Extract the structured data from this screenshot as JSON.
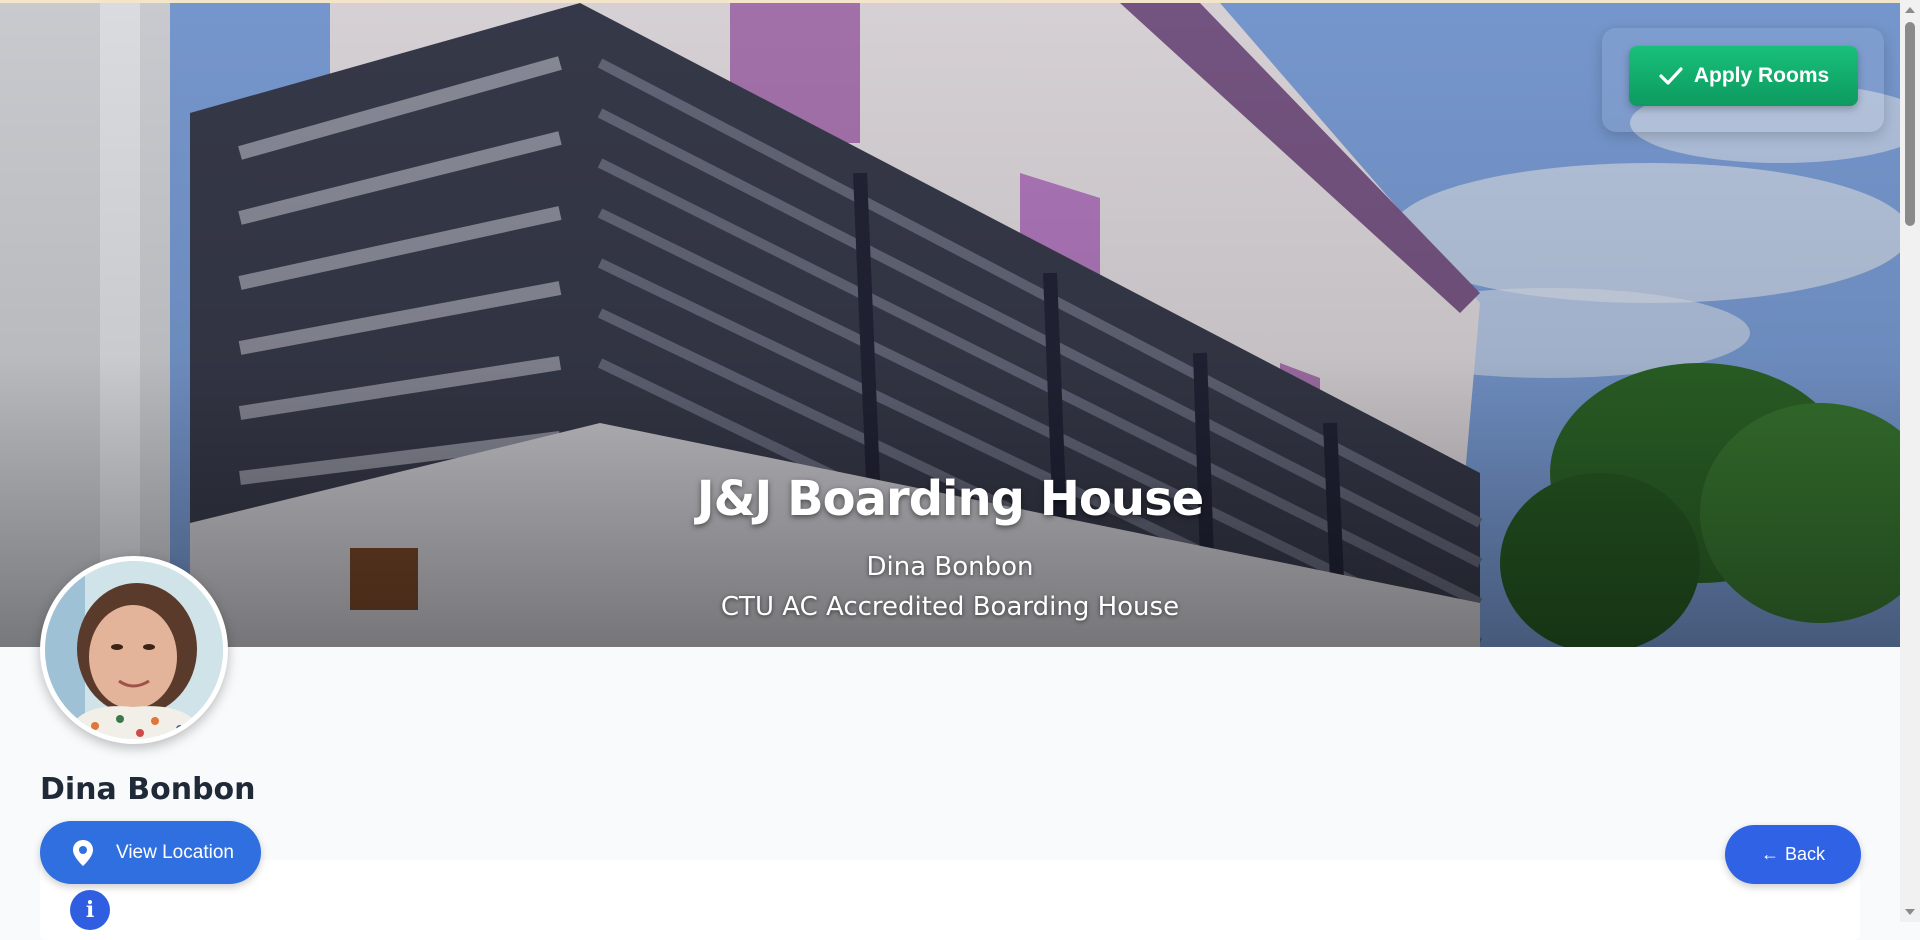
{
  "hero": {
    "title": "J&J Boarding House",
    "owner": "Dina Bonbon",
    "subtitle": "CTU AC Accredited Boarding House"
  },
  "apply_button": {
    "label": "Apply Rooms",
    "icon": "check-icon",
    "color": "#10b06c"
  },
  "profile": {
    "name": "Dina Bonbon",
    "avatar_icon": "avatar"
  },
  "view_location": {
    "label": "View Location",
    "icon": "location-pin-icon",
    "color": "#2f6fe0"
  },
  "back_button": {
    "label": "Back",
    "arrow": "←",
    "icon": "arrow-left-icon",
    "color": "#2f62e5"
  },
  "info_icon": {
    "icon": "info-icon",
    "glyph": "i"
  }
}
